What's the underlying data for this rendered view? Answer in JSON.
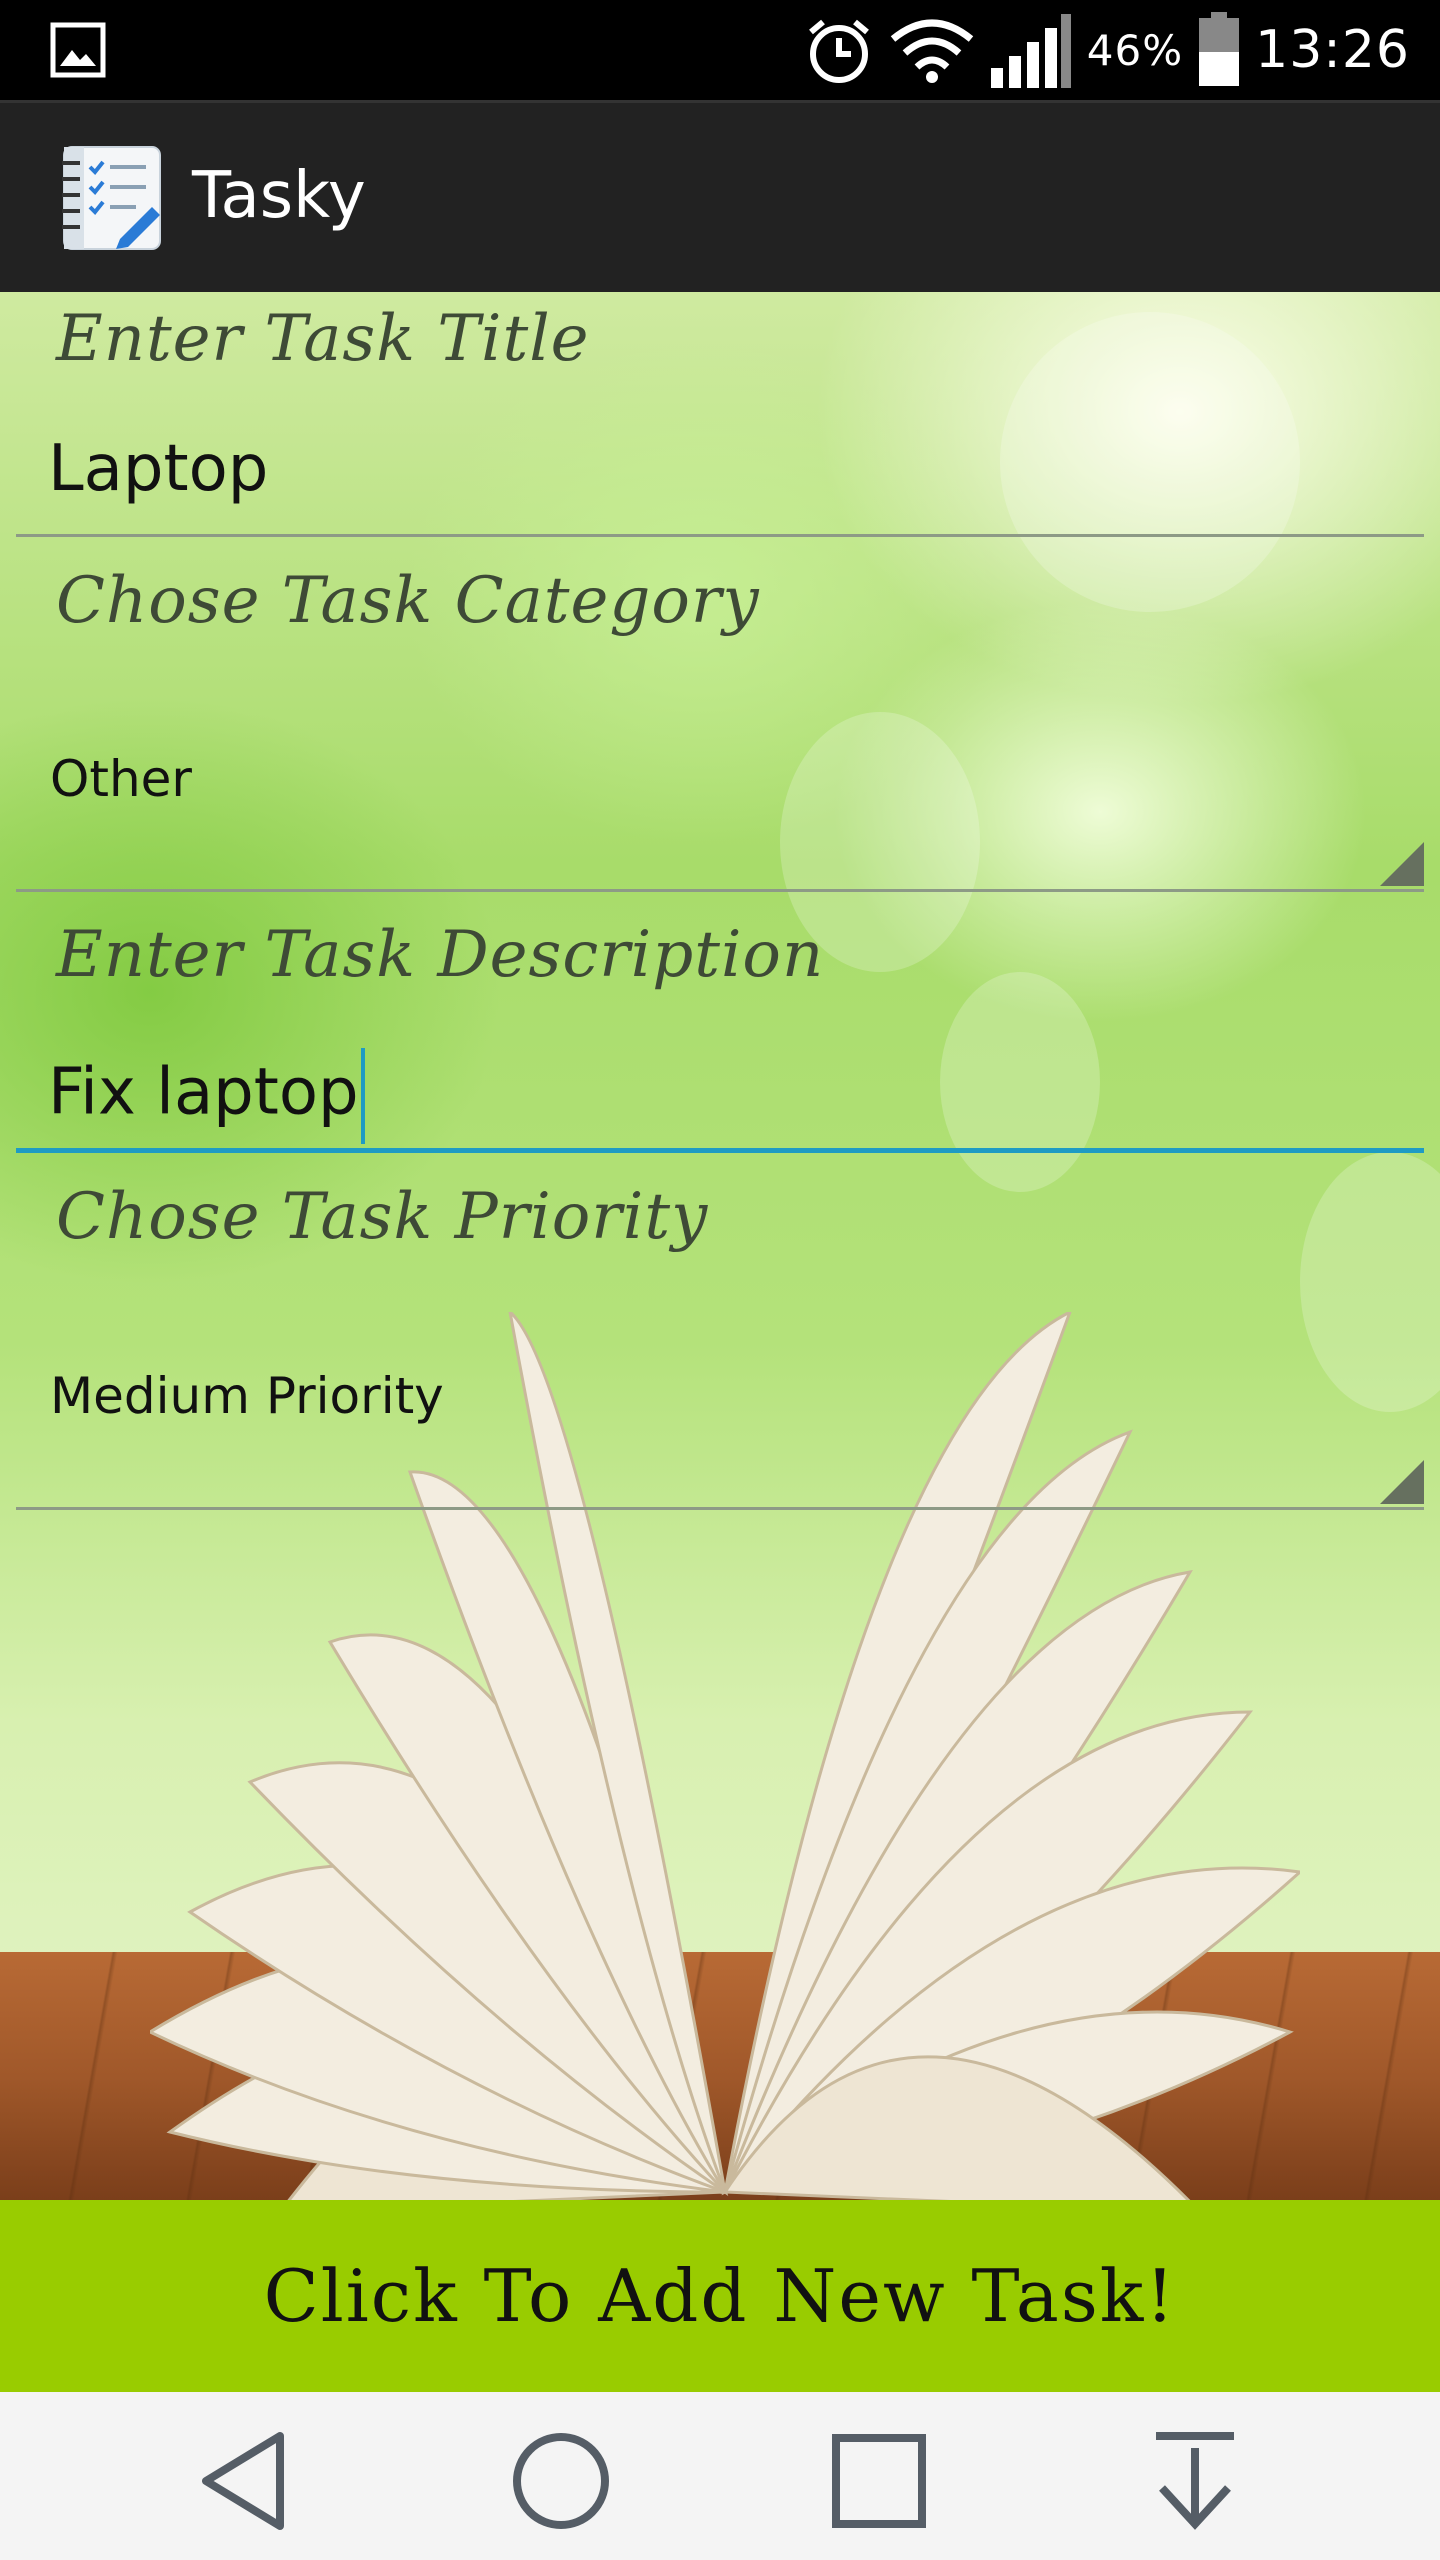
{
  "status_bar": {
    "battery_percent": "46%",
    "time": "13:26",
    "icons": [
      "image-notification-icon",
      "alarm-icon",
      "wifi-icon",
      "signal-icon",
      "battery-icon"
    ]
  },
  "app_bar": {
    "title": "Tasky",
    "icon": "notebook-checklist-icon"
  },
  "form": {
    "title_label": "Enter Task Title",
    "title_value": "Laptop",
    "category_label": "Chose Task Category",
    "category_value": "Other",
    "description_label": "Enter Task Description",
    "description_value": "Fix laptop",
    "priority_label": "Chose Task Priority",
    "priority_value": "Medium Priority"
  },
  "add_button": {
    "label": "Click To Add New Task!"
  },
  "nav_bar": {
    "buttons": [
      "back-icon",
      "home-icon",
      "recents-icon",
      "notification-pull-icon"
    ]
  },
  "colors": {
    "accent_button": "#99cc00",
    "focus_underline": "#1e9bc4",
    "action_bar": "#222222"
  }
}
